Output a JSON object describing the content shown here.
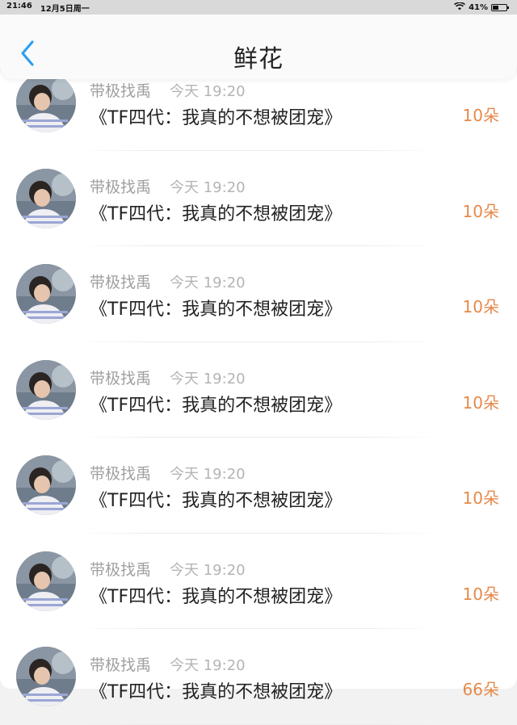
{
  "status_bar": {
    "time": "21:46",
    "date": "12月5日周一",
    "battery": "41%",
    "battery_level": 0.41
  },
  "nav": {
    "title": "鲜花",
    "back_icon": "chevron-left-icon",
    "accent_color": "#2e9ff0"
  },
  "items": [
    {
      "user": "带极找禹",
      "time": "今天 19:20",
      "title": "《TF四代：我真的不想被团宠》",
      "flowers": "10朵"
    },
    {
      "user": "带极找禹",
      "time": "今天 19:20",
      "title": "《TF四代：我真的不想被团宠》",
      "flowers": "10朵"
    },
    {
      "user": "带极找禹",
      "time": "今天 19:20",
      "title": "《TF四代：我真的不想被团宠》",
      "flowers": "10朵"
    },
    {
      "user": "带极找禹",
      "time": "今天 19:20",
      "title": "《TF四代：我真的不想被团宠》",
      "flowers": "10朵"
    },
    {
      "user": "带极找禹",
      "time": "今天 19:20",
      "title": "《TF四代：我真的不想被团宠》",
      "flowers": "10朵"
    },
    {
      "user": "带极找禹",
      "time": "今天 19:20",
      "title": "《TF四代：我真的不想被团宠》",
      "flowers": "10朵"
    },
    {
      "user": "带极找禹",
      "time": "今天 19:20",
      "title": "《TF四代：我真的不想被团宠》",
      "flowers": "66朵"
    }
  ]
}
